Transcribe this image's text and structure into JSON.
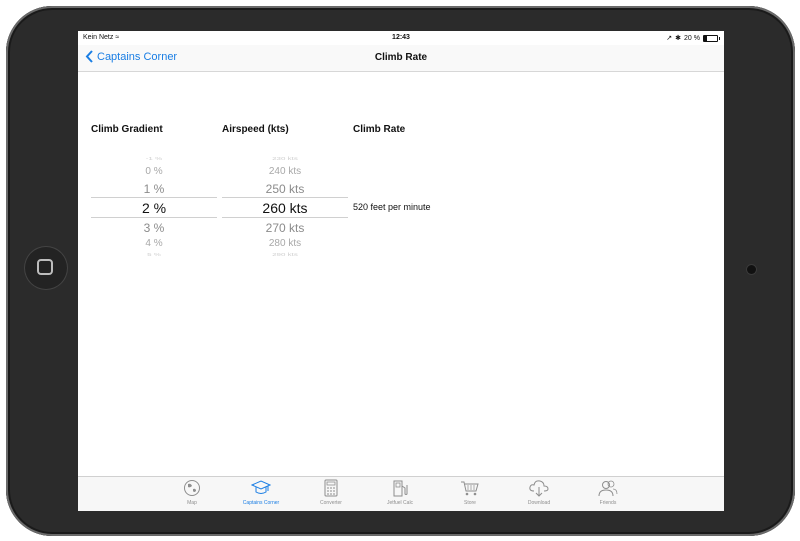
{
  "status_bar": {
    "carrier": "Kein Netz",
    "time": "12:43",
    "battery": "20 %"
  },
  "nav": {
    "back_label": "Captains Corner",
    "title": "Climb Rate"
  },
  "columns": {
    "gradient_header": "Climb Gradient",
    "airspeed_header": "Airspeed (kts)",
    "climbrate_header": "Climb Rate"
  },
  "gradient_picker": {
    "rows": [
      "-1 %",
      "0 %",
      "1 %",
      "2 %",
      "3 %",
      "4 %",
      "5 %"
    ],
    "selected": "2 %"
  },
  "airspeed_picker": {
    "rows": [
      "230 kts",
      "240 kts",
      "250 kts",
      "260 kts",
      "270 kts",
      "280 kts",
      "290 kts"
    ],
    "selected": "260 kts"
  },
  "result": "520 feet per minute",
  "tabs": [
    {
      "label": "Map",
      "icon": "globe-icon"
    },
    {
      "label": "Captains Corner",
      "icon": "graduation-cap-icon"
    },
    {
      "label": "Converter",
      "icon": "calculator-icon"
    },
    {
      "label": "Jetfuel Calc",
      "icon": "fuel-pump-icon"
    },
    {
      "label": "Store",
      "icon": "cart-icon"
    },
    {
      "label": "Download",
      "icon": "cloud-download-icon"
    },
    {
      "label": "Friends",
      "icon": "friends-icon"
    }
  ],
  "colors": {
    "accent": "#1a7ee4",
    "inactive": "#8e8e8e"
  }
}
